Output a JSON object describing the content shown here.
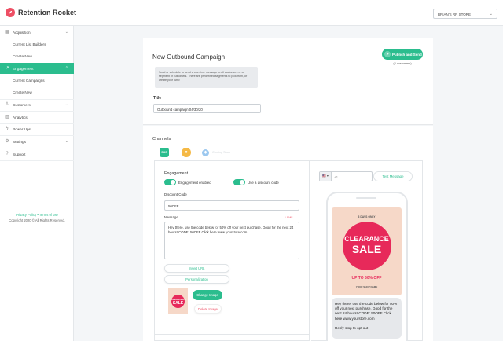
{
  "app": {
    "name": "Retention Rocket"
  },
  "store_selector": {
    "value": "BRIAN'S RR STORE"
  },
  "sidebar": {
    "items": [
      {
        "label": "Acquisition",
        "icon": "grid-icon",
        "has_chevron": true
      },
      {
        "label": "Current List Builders"
      },
      {
        "label": "Create New"
      },
      {
        "label": "Engagement",
        "icon": "trend-icon",
        "active": true
      },
      {
        "label": "Current Campaigns"
      },
      {
        "label": "Create New"
      },
      {
        "label": "Customers",
        "icon": "person-icon"
      },
      {
        "label": "Analytics",
        "icon": "chart-icon"
      },
      {
        "label": "Power Ups",
        "icon": "bolt-icon"
      },
      {
        "label": "Settings",
        "icon": "gear-icon"
      },
      {
        "label": "Support",
        "icon": "help-icon"
      }
    ],
    "footer": {
      "privacy": "Privacy Policy",
      "separator": "•",
      "terms": "Terms of use",
      "copyright": "Copyright 2020 © All Rights Reserved."
    }
  },
  "page": {
    "title": "New Outbound Campaign",
    "publish_label": "Publish and Send",
    "customer_count": "(4 customers)",
    "info_text": "Send or schedule to send a one-time message to all customers or a segment of customers. There are predefined segments to pick from, or create your own!",
    "title_label": "Title",
    "title_value": "Outbound campaign 04/30/20"
  },
  "channels": {
    "label": "Channels",
    "tabs": [
      {
        "label": "SMS",
        "color": "#2bbd8e"
      },
      {
        "label": "",
        "color": "#f5b945"
      },
      {
        "label": "",
        "color": "#9cc8ef"
      }
    ],
    "ghost_label": "Coming Soon"
  },
  "engagement": {
    "label": "Engagement",
    "enabled_label": "Engagement enabled",
    "discount_label": "Use a discount code",
    "discount_code_label": "Discount Code",
    "discount_code": "50OFF",
    "message_label": "Message",
    "char_count": "1 SMS",
    "message": "Hey there, use the code below for 50% off your next purchase. Good for the next 24 hours! CODE: 50OFF Click here www.yourstore.com",
    "insert_url": "Insert URL",
    "personalization": "Personalization",
    "change_image": "Change Image",
    "delete_image": "Delete Image"
  },
  "preview": {
    "country": "🇺🇸 ▾",
    "phone_prefix": "+1",
    "test_label": "Test Message",
    "promo": {
      "top": "3 DAYS ONLY",
      "line1": "CLEARANCE",
      "line2": "SALE",
      "line3": "UP TO 50% OFF",
      "line4": "YOUR SHOP NAME"
    },
    "bubble_text": "Hey there, use the code below for 50% off your next purchase. Good for the next 24 hours! CODE: 50OFF Click here www.yourstore.com",
    "stop_text": "Reply stop to opt out"
  },
  "colors": {
    "accent": "#2bbd8e",
    "brand": "#ee4f64",
    "promo_red": "#e7295a"
  }
}
